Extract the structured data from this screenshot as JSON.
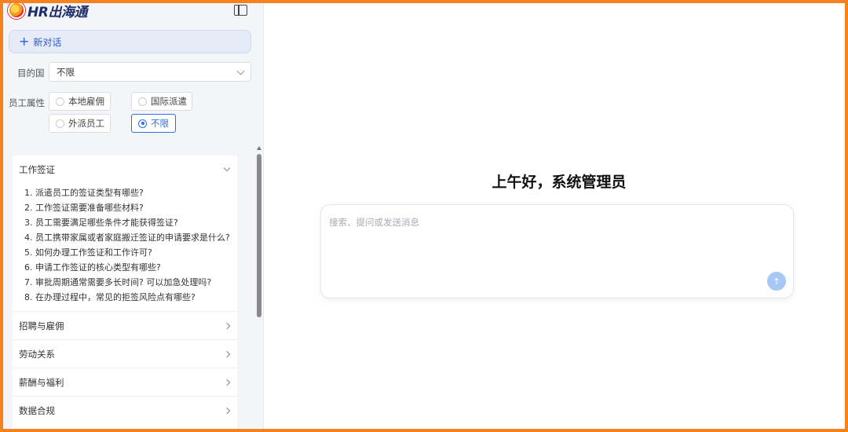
{
  "app": {
    "logo_text": "HR出海通"
  },
  "sidebar": {
    "new_chat_label": "新对话",
    "destination": {
      "label": "目的国",
      "value": "不限"
    },
    "employee_type": {
      "label": "员工属性",
      "options": [
        {
          "label": "本地雇佣",
          "selected": false
        },
        {
          "label": "国际派遣",
          "selected": false
        },
        {
          "label": "外派员工",
          "selected": false
        },
        {
          "label": "不限",
          "selected": true
        }
      ]
    },
    "categories": [
      {
        "title": "工作签证",
        "expanded": true,
        "questions": [
          "1. 派遣员工的签证类型有哪些?",
          "2. 工作签证需要准备哪些材料?",
          "3. 员工需要满足哪些条件才能获得签证?",
          "4. 员工携带家属或者家庭搬迁签证的申请要求是什么?",
          "5. 如何办理工作签证和工作许可?",
          "6. 申请工作签证的核心类型有哪些?",
          "7. 审批周期通常需要多长时间? 可以加急处理吗?",
          "8. 在办理过程中，常见的拒签风险点有哪些?"
        ]
      },
      {
        "title": "招聘与雇佣",
        "expanded": false
      },
      {
        "title": "劳动关系",
        "expanded": false
      },
      {
        "title": "薪酬与福利",
        "expanded": false
      },
      {
        "title": "数据合规",
        "expanded": false
      }
    ]
  },
  "main": {
    "greeting": "上午好，系统管理员",
    "input_placeholder": "搜索、提问或发送消息"
  },
  "colors": {
    "accent": "#2f6fe0",
    "frame": "#f5821f",
    "send_button": "#a7c7f5"
  }
}
